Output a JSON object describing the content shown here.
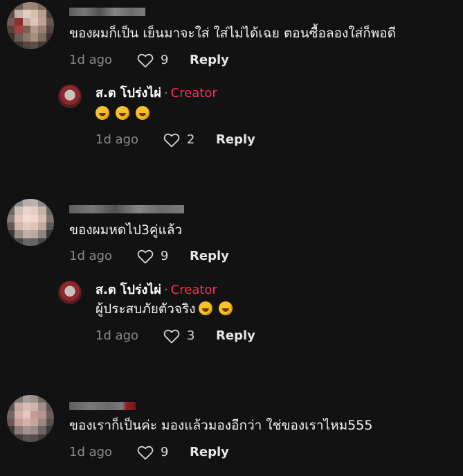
{
  "comments": [
    {
      "text": "ของผมก็เป็น เย็นมาจะใส่ ใส่ไม่ได้เฉย ตอนซื้อลองใส่ก็พอดี",
      "time": "1d ago",
      "likes": "9",
      "reply_label": "Reply",
      "reply": {
        "author": "ส.ต โปร่งไผ่",
        "separator": "·",
        "badge": "Creator",
        "text": "",
        "emoji_count": 3,
        "time": "1d ago",
        "likes": "2",
        "reply_label": "Reply"
      }
    },
    {
      "text": "ของผมหดไป3คู่แล้ว",
      "time": "1d ago",
      "likes": "9",
      "reply_label": "Reply",
      "reply": {
        "author": "ส.ต โปร่งไผ่",
        "separator": "·",
        "badge": "Creator",
        "text": "ผู้ประสบภัยตัวจริง",
        "emoji_count": 2,
        "time": "1d ago",
        "likes": "3",
        "reply_label": "Reply"
      }
    },
    {
      "text": "ของเราก็เป็นค่ะ มองแล้วมองอีกว่า ใช่ของเราไหม555",
      "time": "1d ago",
      "likes": "9",
      "reply_label": "Reply"
    }
  ],
  "colors": {
    "background": "#121212",
    "creator_badge": "#fe2c55",
    "muted": "#8a8a8a"
  },
  "icons": {
    "like": "heart-outline-icon",
    "emoji": "rolling-on-floor-laughing-emoji"
  }
}
